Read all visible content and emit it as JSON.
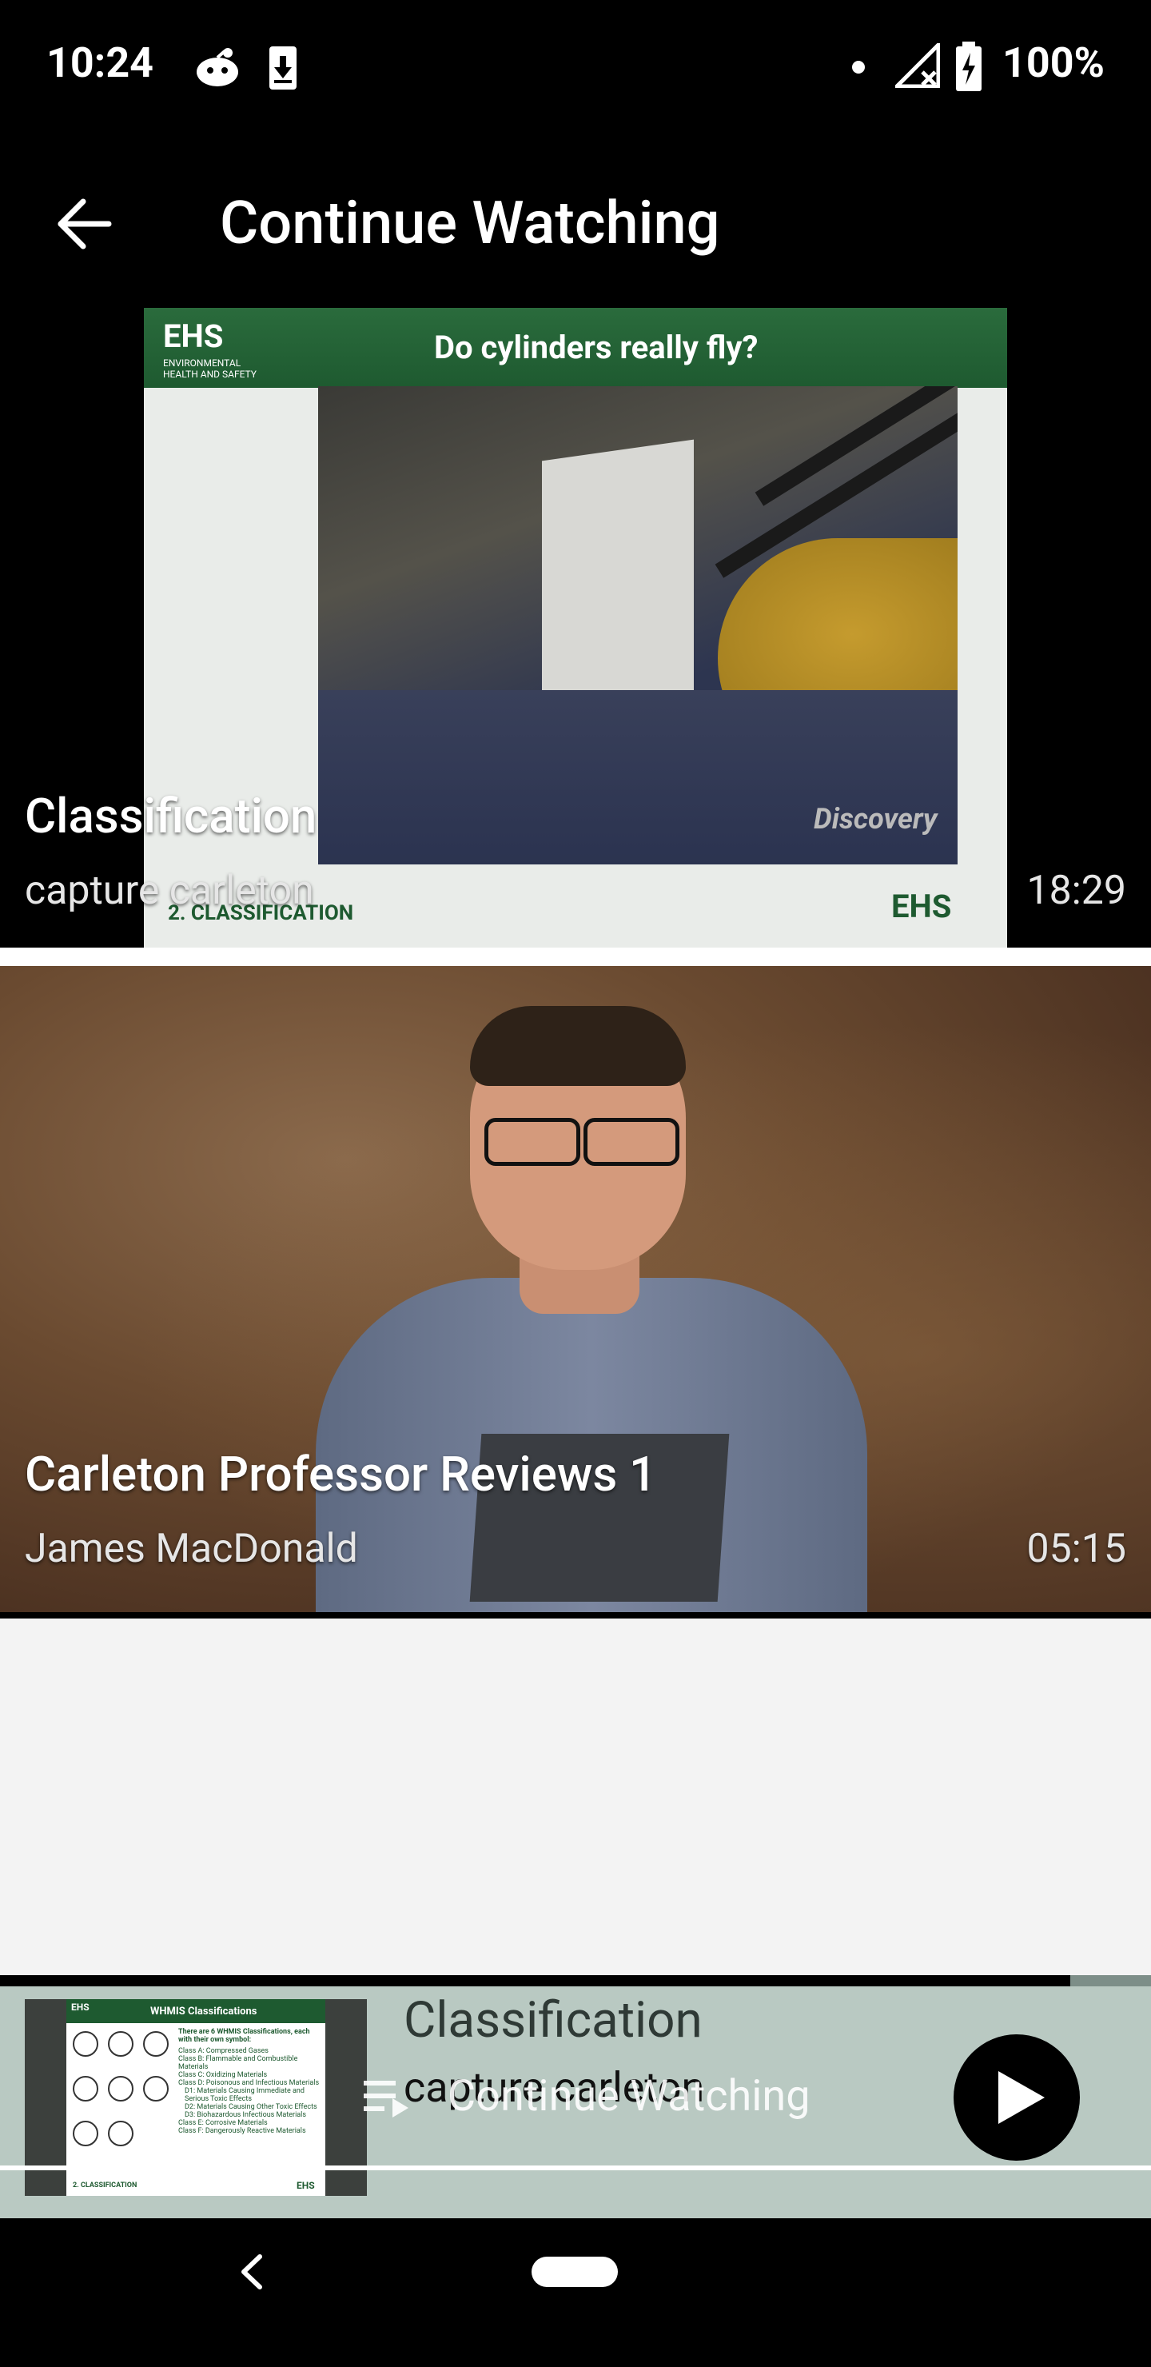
{
  "status_bar": {
    "time": "10:24",
    "battery": "100%",
    "icons": [
      "reddit-icon",
      "download-icon",
      "dot-icon",
      "signal-off-icon",
      "battery-charging-icon"
    ]
  },
  "app_bar": {
    "title": "Continue Watching",
    "back_icon": "arrow-back-icon"
  },
  "videos": [
    {
      "title": "Classification",
      "subtitle": "capture carleton",
      "duration": "18:29",
      "thumbnail": {
        "header_logo": "EHS",
        "header_logo_sub": "ENVIRONMENTAL HEALTH AND SAFETY",
        "slide_heading": "Do cylinders really fly?",
        "footer_text": "2.   CLASSIFICATION",
        "watermark": "Discovery",
        "footer_logo": "EHS"
      }
    },
    {
      "title": "Carleton Professor Reviews 1",
      "subtitle": "James MacDonald",
      "duration": "05:15"
    }
  ],
  "mini_player": {
    "title": "Classification",
    "subtitle": "capture carleton",
    "overlay_label": "Continue Watching",
    "progress": 0.93,
    "thumbnail": {
      "logo": "EHS",
      "heading": "WHMIS Classifications",
      "intro": "There are 6 WHMIS Classifications, each with their own symbol:",
      "items": [
        "Class A: Compressed Gases",
        "Class B: Flammable and Combustible Materials",
        "Class C: Oxidizing Materials",
        "Class D: Poisonous and Infectious Materials",
        "D1: Materials Causing Immediate and Serious Toxic Effects",
        "D2: Materials Causing Other Toxic Effects",
        "D3: Biohazardous Infectious Materials",
        "Class E: Corrosive Materials",
        "Class F: Dangerously Reactive Materials"
      ],
      "footer": "2.   CLASSIFICATION",
      "footer_logo": "EHS"
    }
  },
  "colors": {
    "app_bg": "#f3f3f3",
    "bar_bg": "#000000",
    "mini_player_bg": "#b9c9c2",
    "ehs_green": "#1e5a30"
  }
}
